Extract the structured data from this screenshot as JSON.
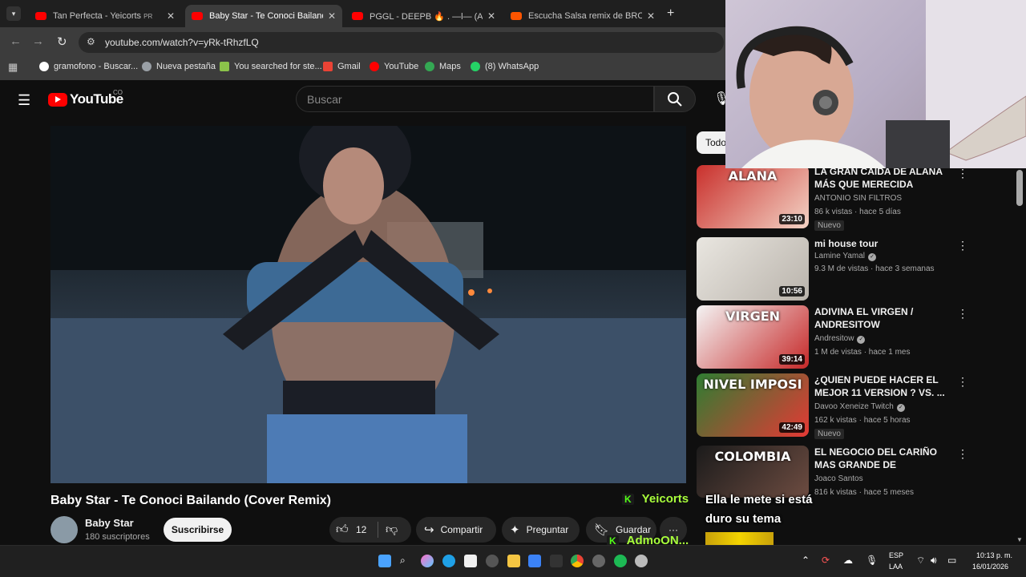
{
  "browser": {
    "tabs": [
      {
        "title": "Tan Perfecta - Yeicorts",
        "extra": "PR",
        "icon": "youtube-icon"
      },
      {
        "title": "Baby Star - Te Conoci Bailando",
        "icon": "youtube-icon",
        "active": true
      },
      {
        "title": "PGGL - DEEPB 🔥 . —l— (Audio",
        "icon": "youtube-icon"
      },
      {
        "title": "Escucha Salsa remix de BROX |",
        "icon": "soundcloud-icon"
      }
    ],
    "url": "youtube.com/watch?v=yRk-tRhzfLQ",
    "bookmarks": [
      {
        "label": "gramofono - Buscar...",
        "color": "#ffffff"
      },
      {
        "label": "Nueva pestaña",
        "color": "#9aa0a6"
      },
      {
        "label": "You searched for ste...",
        "color": "#8bc34a"
      },
      {
        "label": "Gmail",
        "color": "#ea4335"
      },
      {
        "label": "YouTube",
        "color": "#ff0000"
      },
      {
        "label": "Maps",
        "color": "#34a853"
      },
      {
        "label": "(8) WhatsApp",
        "color": "#25d366"
      }
    ]
  },
  "youtube": {
    "logo_text": "YouTube",
    "country": "CO",
    "search_placeholder": "Buscar",
    "video": {
      "title": "Baby Star - Te Conoci Bailando (Cover Remix)",
      "channel": "Baby Star",
      "subscribers": "180 suscriptores",
      "subscribe_label": "Suscribirse",
      "likes": "12",
      "share_label": "Compartir",
      "ask_label": "Preguntar",
      "save_label": "Guardar",
      "more_label": "···"
    },
    "chip_label": "Todo",
    "recommendations": [
      {
        "title": "LA GRAN CAIDA DE ALANA MÁS QUE MERECIDA",
        "channel": "ANTONIO SIN FILTROS",
        "verified": false,
        "meta": "86 k vistas · hace 5 días",
        "badge": "Nuevo",
        "duration": "23:10",
        "thumb_text": "ALANA",
        "thumb_colors": [
          "#c9302c",
          "#f3d3c5"
        ]
      },
      {
        "title": "mi house tour",
        "channel": "Lamine Yamal",
        "verified": true,
        "meta": "9.3 M de vistas · hace 3 semanas",
        "badge": "",
        "duration": "10:56",
        "thumb_text": "",
        "thumb_colors": [
          "#e9e6e0",
          "#b9b3ab"
        ]
      },
      {
        "title": "ADIVINA EL VIRGEN / ANDRESITOW",
        "channel": "Andresitow",
        "verified": true,
        "meta": "1 M de vistas · hace 1 mes",
        "badge": "",
        "duration": "39:14",
        "thumb_text": "VIRGEN",
        "thumb_colors": [
          "#f4f4f4",
          "#c62828"
        ]
      },
      {
        "title": "¿QUIEN PUEDE HACER EL MEJOR 11 VERSION ? VS. ...",
        "channel": "Davoo Xeneize Twitch",
        "verified": true,
        "meta": "162 k vistas · hace 5 horas",
        "badge": "Nuevo",
        "duration": "42:49",
        "thumb_text": "NIVEL IMPOSI",
        "thumb_colors": [
          "#2e7d32",
          "#e53935"
        ]
      },
      {
        "title": "EL NEGOCIO DEL CARIÑO MAS GRANDE DE LATINOAMERICA ...",
        "channel": "Joaco Santos",
        "verified": false,
        "meta": "816 k vistas · hace 5 meses",
        "badge": "",
        "duration": "",
        "thumb_text": "COLOMBIA",
        "thumb_colors": [
          "#1b1b1b",
          "#6d4c41"
        ]
      }
    ]
  },
  "overlay": {
    "user1": "Yeicorts",
    "user2": "AdmoON...",
    "kick_letter": "K",
    "message": "Ella le mete si está duro su tema"
  },
  "taskbar": {
    "lang1": "ESP",
    "lang2": "LAA",
    "time": "10:13 p. m.",
    "date": "16/01/2026"
  }
}
